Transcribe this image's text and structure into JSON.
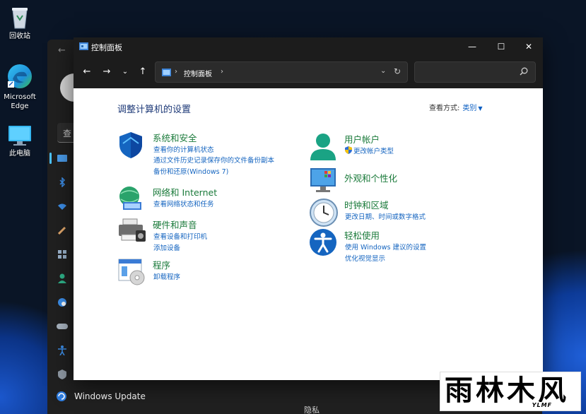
{
  "desktop": {
    "icons": [
      {
        "label": "回收站"
      },
      {
        "label": "Microsoft Edge"
      },
      {
        "label": "此电脑"
      }
    ]
  },
  "settings": {
    "search_text": "查",
    "windows_update_label": "Windows Update",
    "bottom_fragment": "隐私"
  },
  "window": {
    "title": "控制面板",
    "controls": {
      "minimize": "—",
      "maximize": "☐",
      "close": "✕"
    }
  },
  "toolbar": {
    "address_segment": "控制面板",
    "search_placeholder": ""
  },
  "content": {
    "heading": "调整计算机的设置",
    "view_by_label": "查看方式:",
    "view_by_value": "类别",
    "categories": [
      {
        "title": "系统和安全",
        "links": [
          "查看你的计算机状态",
          "通过文件历史记录保存你的文件备份副本",
          "备份和还原(Windows 7)"
        ]
      },
      {
        "title": "网络和 Internet",
        "links": [
          "查看网络状态和任务"
        ]
      },
      {
        "title": "硬件和声音",
        "links": [
          "查看设备和打印机",
          "添加设备"
        ]
      },
      {
        "title": "程序",
        "links": [
          "卸载程序"
        ]
      },
      {
        "title": "用户帐户",
        "links": [
          "更改帐户类型"
        ]
      },
      {
        "title": "外观和个性化",
        "links": []
      },
      {
        "title": "时钟和区域",
        "links": [
          "更改日期、时间或数字格式"
        ]
      },
      {
        "title": "轻松使用",
        "links": [
          "使用 Windows 建议的设置",
          "优化视觉显示"
        ]
      }
    ]
  },
  "watermark": {
    "text": "雨林木风",
    "sub": "YLMF"
  },
  "colors": {
    "accent": "#4cc2ff",
    "category_title": "#1a7a3a",
    "link": "#1565c0",
    "heading": "#1e3a78"
  }
}
